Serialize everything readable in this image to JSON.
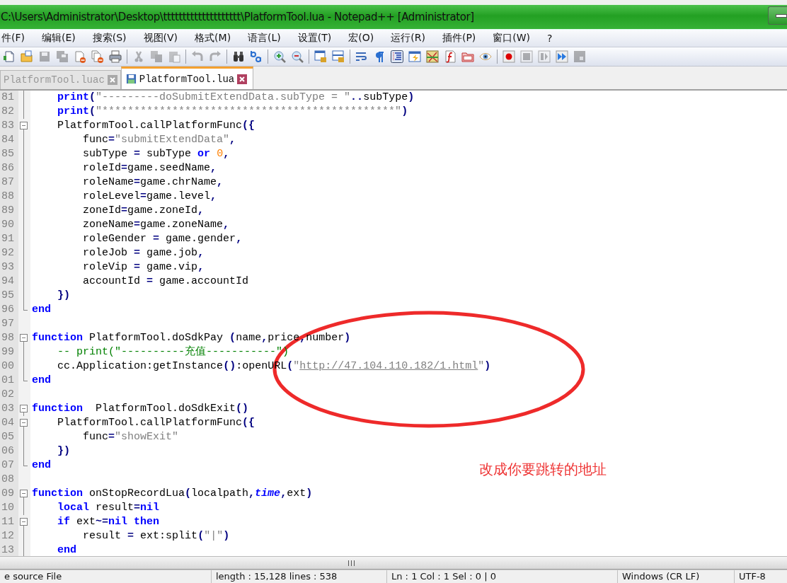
{
  "window": {
    "title": "C:\\Users\\Administrator\\Desktop\\tttttttttttttttttttt\\PlatformTool.lua - Notepad++ [Administrator]"
  },
  "menu": [
    "件(F)",
    "编辑(E)",
    "搜索(S)",
    "视图(V)",
    "格式(M)",
    "语言(L)",
    "设置(T)",
    "宏(O)",
    "运行(R)",
    "插件(P)",
    "窗口(W)",
    "?"
  ],
  "toolbar": {
    "groups": [
      [
        {
          "kind": "new",
          "disabled": false,
          "selected": false
        },
        {
          "kind": "open",
          "disabled": false,
          "selected": false
        },
        {
          "kind": "save",
          "disabled": true,
          "selected": false
        },
        {
          "kind": "saveall",
          "disabled": true,
          "selected": false
        },
        {
          "kind": "close",
          "disabled": false,
          "selected": false
        },
        {
          "kind": "closeall",
          "disabled": false,
          "selected": false
        },
        {
          "kind": "print",
          "disabled": false,
          "selected": false
        }
      ],
      [
        {
          "kind": "cut",
          "disabled": true,
          "selected": false
        },
        {
          "kind": "copy",
          "disabled": true,
          "selected": false
        },
        {
          "kind": "paste",
          "disabled": true,
          "selected": false
        }
      ],
      [
        {
          "kind": "undo",
          "disabled": true,
          "selected": false
        },
        {
          "kind": "redo",
          "disabled": true,
          "selected": false
        }
      ],
      [
        {
          "kind": "find",
          "disabled": false,
          "selected": false
        },
        {
          "kind": "replace",
          "disabled": false,
          "selected": false
        }
      ],
      [
        {
          "kind": "zoomin",
          "disabled": false,
          "selected": false
        },
        {
          "kind": "zoomout",
          "disabled": false,
          "selected": false
        }
      ],
      [
        {
          "kind": "syncv",
          "disabled": false,
          "selected": false
        },
        {
          "kind": "synch",
          "disabled": false,
          "selected": false
        }
      ],
      [
        {
          "kind": "wrap",
          "disabled": false,
          "selected": false
        },
        {
          "kind": "allchars",
          "disabled": false,
          "selected": false
        },
        {
          "kind": "indent",
          "disabled": false,
          "selected": true
        },
        {
          "kind": "lang",
          "disabled": false,
          "selected": false
        },
        {
          "kind": "map",
          "disabled": false,
          "selected": false
        },
        {
          "kind": "func",
          "disabled": false,
          "selected": false
        },
        {
          "kind": "folder",
          "disabled": false,
          "selected": false
        },
        {
          "kind": "eye",
          "disabled": false,
          "selected": false
        }
      ],
      [
        {
          "kind": "record",
          "disabled": false,
          "selected": false
        },
        {
          "kind": "stop",
          "disabled": true,
          "selected": false
        },
        {
          "kind": "play",
          "disabled": true,
          "selected": false
        },
        {
          "kind": "playmulti",
          "disabled": false,
          "selected": false
        },
        {
          "kind": "savemacro",
          "disabled": true,
          "selected": false
        }
      ]
    ]
  },
  "tabs": [
    {
      "label": "PlatformTool.luac",
      "selected": false
    },
    {
      "label": "PlatformTool.lua",
      "selected": true
    }
  ],
  "editor": {
    "lines": [
      {
        "number": "81",
        "kind": "body",
        "text": "    print(\"---------doSubmitExtendData.subType = \"..subType)"
      },
      {
        "number": "82",
        "kind": "body",
        "text": "    print(\"**********************************************\")"
      },
      {
        "number": "83",
        "kind": "start",
        "text": "    PlatformTool.callPlatformFunc({"
      },
      {
        "number": "84",
        "kind": "body",
        "text": "        func=\"submitExtendData\","
      },
      {
        "number": "85",
        "kind": "body",
        "text": "        subType = subType or 0,"
      },
      {
        "number": "86",
        "kind": "body",
        "text": "        roleId=game.seedName,"
      },
      {
        "number": "87",
        "kind": "body",
        "text": "        roleName=game.chrName,"
      },
      {
        "number": "88",
        "kind": "body",
        "text": "        roleLevel=game.level,"
      },
      {
        "number": "89",
        "kind": "body",
        "text": "        zoneId=game.zoneId,"
      },
      {
        "number": "90",
        "kind": "body",
        "text": "        zoneName=game.zoneName,"
      },
      {
        "number": "91",
        "kind": "body",
        "text": "        roleGender = game.gender,"
      },
      {
        "number": "92",
        "kind": "body",
        "text": "        roleJob = game.job,"
      },
      {
        "number": "93",
        "kind": "body",
        "text": "        roleVip = game.vip,"
      },
      {
        "number": "94",
        "kind": "body",
        "text": "        accountId = game.accountId"
      },
      {
        "number": "95",
        "kind": "tail",
        "text": "    })"
      },
      {
        "number": "96",
        "kind": "end",
        "text": "end"
      },
      {
        "number": "97",
        "kind": "plain"
      },
      {
        "number": "98",
        "kind": "start",
        "text": "function PlatformTool.doSdkPay (name,price,number)"
      },
      {
        "number": "99",
        "kind": "body",
        "text": "    -- print(\"----------充值-----------\")"
      },
      {
        "number": "00",
        "kind": "body",
        "text": "    cc.Application:getInstance():openURL(\"http://47.104.110.182/1.html\")"
      },
      {
        "number": "01",
        "kind": "end",
        "text": "end"
      },
      {
        "number": "02",
        "kind": "plain"
      },
      {
        "number": "03",
        "kind": "start",
        "text": "function  PlatformTool.doSdkExit()"
      },
      {
        "number": "04",
        "kind": "start",
        "text": "    PlatformTool.callPlatformFunc({"
      },
      {
        "number": "05",
        "kind": "body",
        "text": "        func=\"showExit\""
      },
      {
        "number": "06",
        "kind": "tail",
        "text": "    })"
      },
      {
        "number": "07",
        "kind": "end",
        "text": "end"
      },
      {
        "number": "08",
        "kind": "plain"
      },
      {
        "number": "09",
        "kind": "start",
        "text": "function onStopRecordLua(localpath,time,ext)"
      },
      {
        "number": "10",
        "kind": "body",
        "text": "    local result=nil"
      },
      {
        "number": "11",
        "kind": "start",
        "text": "    if ext~=nil then"
      },
      {
        "number": "12",
        "kind": "body",
        "text": "        result = ext:split(\"|\")"
      },
      {
        "number": "13",
        "kind": "tail",
        "text": "    end"
      }
    ]
  },
  "annotation": {
    "text": "改成你要跳转的地址"
  },
  "status_bar": [
    "e source File",
    "length : 15,128    lines : 538",
    "Ln : 1    Col : 1    Sel : 0 | 0",
    "Windows (CR LF)",
    "UTF-8"
  ]
}
